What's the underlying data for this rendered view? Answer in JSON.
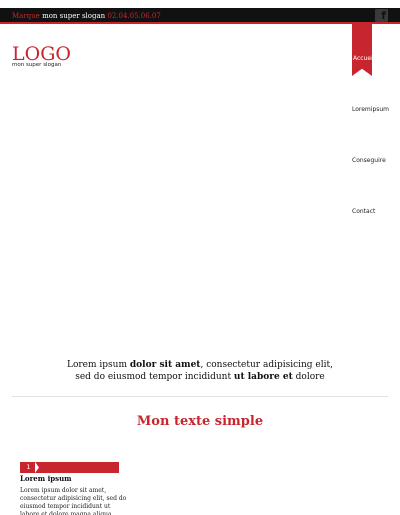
{
  "topbar": {
    "brand": "Marque",
    "slogan": "mon super slogan",
    "phone": "02.04.05.06.07",
    "facebook_icon": "facebook-icon"
  },
  "header": {
    "logo": "LOGO",
    "slogan": "mon super slogan"
  },
  "nav": {
    "items": [
      {
        "label": "Accueil",
        "active": true
      },
      {
        "label": "Loremipsum",
        "active": false
      },
      {
        "label": "Conseguire",
        "active": false
      },
      {
        "label": "Contact",
        "active": false
      }
    ]
  },
  "intro": {
    "line1_a": "Lorem ipsum ",
    "line1_b": "dolor sit amet",
    "line1_c": ", consectetur adipisicing elit,",
    "line2_a": "sed do eiusmod tempor incididunt ",
    "line2_b": "ut labore et",
    "line2_c": " dolore"
  },
  "section": {
    "title": "Mon texte simple"
  },
  "card": {
    "number": "1",
    "title": "Lorem ipsum",
    "text": "Lorem ipsum dolor sit amet, consectetur adipisicing elit, sed do eiusmod tempor incididunt ut labore et dolore magna aliqua."
  },
  "colors": {
    "accent": "#c8262e",
    "topbar": "#111111"
  }
}
